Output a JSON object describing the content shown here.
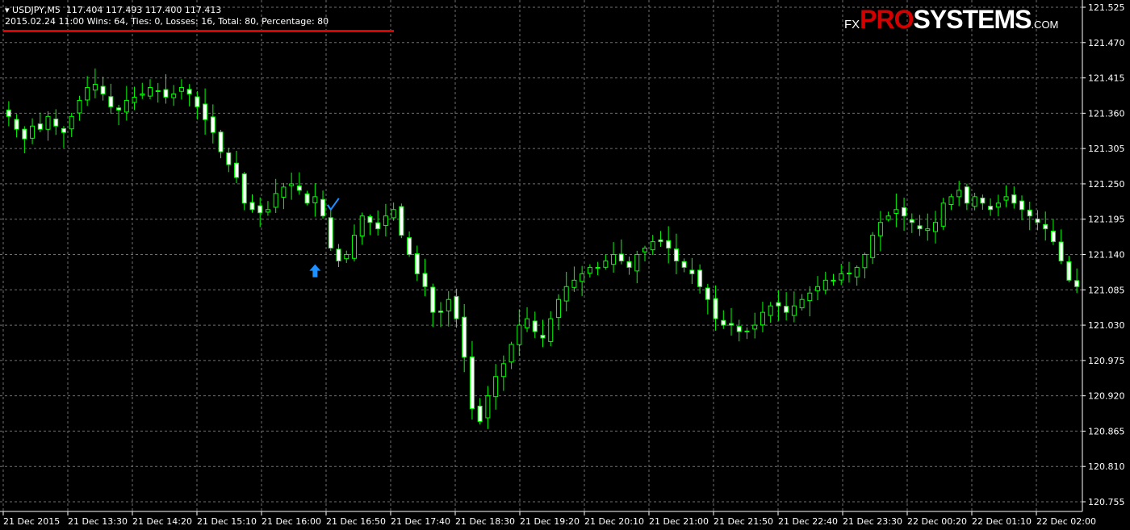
{
  "header": {
    "symbol_line": "USDJPY,M5  117.404 117.493 117.400 117.413",
    "stats_line": "2015.02.24 11:00 Wins: 64, Ties: 0, Losses: 16, Total: 80, Percentage: 80"
  },
  "logo": {
    "fx": "FX",
    "pro": "PRO",
    "systems": "SYSTEMS",
    "com": ".COM"
  },
  "colors": {
    "background": "#000000",
    "grid": "#6f6f6f",
    "candle": "#00ff00",
    "bull_body": "#000000",
    "bear_body": "#ffffff",
    "signal_arrow": "#1e90ff",
    "stats_underline": "#e00000"
  },
  "chart_data": {
    "type": "candlestick",
    "ylim": [
      120.755,
      121.525
    ],
    "y_ticks": [
      "121.525",
      "121.470",
      "121.415",
      "121.360",
      "121.305",
      "121.250",
      "121.195",
      "121.140",
      "121.085",
      "121.030",
      "120.975",
      "120.920",
      "120.865",
      "120.810",
      "120.755"
    ],
    "x_ticks": [
      "21 Dec 2015",
      "21 Dec 13:30",
      "21 Dec 14:20",
      "21 Dec 15:10",
      "21 Dec 16:00",
      "21 Dec 16:50",
      "21 Dec 17:40",
      "21 Dec 18:30",
      "21 Dec 19:20",
      "21 Dec 20:10",
      "21 Dec 21:00",
      "21 Dec 21:50",
      "21 Dec 22:40",
      "21 Dec 23:30",
      "22 Dec 00:20",
      "22 Dec 01:10",
      "22 Dec 02:00"
    ],
    "grid": true,
    "close_path": [
      121.355,
      121.335,
      121.32,
      121.34,
      121.335,
      121.355,
      121.34,
      121.33,
      121.355,
      121.38,
      121.4,
      121.405,
      121.39,
      121.37,
      121.365,
      121.38,
      121.385,
      121.39,
      121.4,
      121.395,
      121.385,
      121.39,
      121.4,
      121.39,
      121.37,
      121.35,
      121.33,
      121.3,
      121.28,
      121.26,
      121.22,
      121.21,
      121.205,
      121.21,
      121.235,
      121.245,
      121.25,
      121.24,
      121.22,
      121.23,
      121.2,
      121.15,
      121.13,
      121.14,
      121.17,
      121.2,
      121.19,
      121.18,
      121.2,
      121.21,
      121.17,
      121.14,
      121.11,
      121.09,
      121.05,
      121.05,
      121.07,
      121.04,
      120.98,
      120.9,
      120.88,
      120.92,
      120.95,
      120.97,
      121.0,
      121.03,
      121.04,
      121.02,
      121.01,
      121.04,
      121.07,
      121.09,
      121.1,
      121.11,
      121.12,
      121.12,
      121.13,
      121.14,
      121.13,
      121.12,
      121.14,
      121.15,
      121.16,
      121.16,
      121.15,
      121.13,
      121.12,
      121.11,
      121.09,
      121.07,
      121.04,
      121.03,
      121.03,
      121.02,
      121.02,
      121.03,
      121.05,
      121.06,
      121.06,
      121.05,
      121.06,
      121.07,
      121.08,
      121.09,
      121.1,
      121.1,
      121.11,
      121.11,
      121.12,
      121.14,
      121.17,
      121.19,
      121.2,
      121.21,
      121.2,
      121.19,
      121.18,
      121.18,
      121.19,
      121.22,
      121.23,
      121.24,
      121.22,
      121.23,
      121.22,
      121.21,
      121.22,
      121.23,
      121.22,
      121.21,
      121.2,
      121.19,
      121.18,
      121.16,
      121.13,
      121.1,
      121.09
    ],
    "signals": [
      {
        "type": "buy-arrow",
        "bar": 39,
        "price": 121.16
      },
      {
        "type": "check-mark",
        "bar": 41,
        "price": 121.22
      }
    ]
  }
}
